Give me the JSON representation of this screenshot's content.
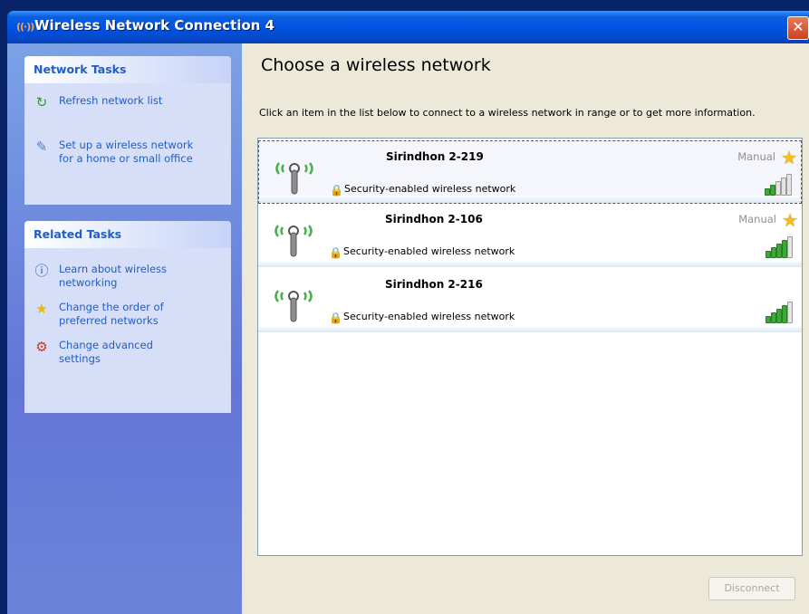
{
  "window": {
    "title": "Wireless Network Connection 4",
    "close_symbol": "✕",
    "icon": "wireless-signal-icon"
  },
  "sidebar": {
    "network_tasks": {
      "heading": "Network Tasks",
      "items": [
        {
          "label_lines": [
            "Refresh network list"
          ],
          "icon": "refresh-icon"
        },
        {
          "label_lines": [
            "Set up a wireless network",
            "for a home or small office"
          ],
          "icon": "setup-wireless-icon"
        }
      ]
    },
    "related_tasks": {
      "heading": "Related Tasks",
      "items": [
        {
          "label_lines": [
            "Learn about wireless",
            "networking"
          ],
          "icon": "info-icon"
        },
        {
          "label_lines": [
            "Change the order of",
            "preferred networks"
          ],
          "icon": "star-icon"
        },
        {
          "label_lines": [
            "Change advanced",
            "settings"
          ],
          "icon": "settings-icon"
        }
      ]
    }
  },
  "main": {
    "heading": "Choose a wireless network",
    "instruction": "Click an item in the list below to connect to a wireless network in range or to get more information.",
    "networks": [
      {
        "ssid": "Sirindhon 2-219",
        "security": "Security-enabled wireless network",
        "mode": "Manual",
        "signal_bars": 2,
        "selected": true
      },
      {
        "ssid": "Sirindhon 2-106",
        "security": "Security-enabled wireless network",
        "mode": "Manual",
        "signal_bars": 4,
        "selected": false
      },
      {
        "ssid": "Sirindhon 2-216",
        "security": "Security-enabled wireless network",
        "mode": "",
        "signal_bars": 4,
        "selected": false
      }
    ],
    "disconnect_label": "Disconnect"
  },
  "colors": {
    "link": "#215dc6",
    "signal_on": "#3aa936",
    "signal_off": "#e4e4e4",
    "accent_star": "#f0c020"
  }
}
